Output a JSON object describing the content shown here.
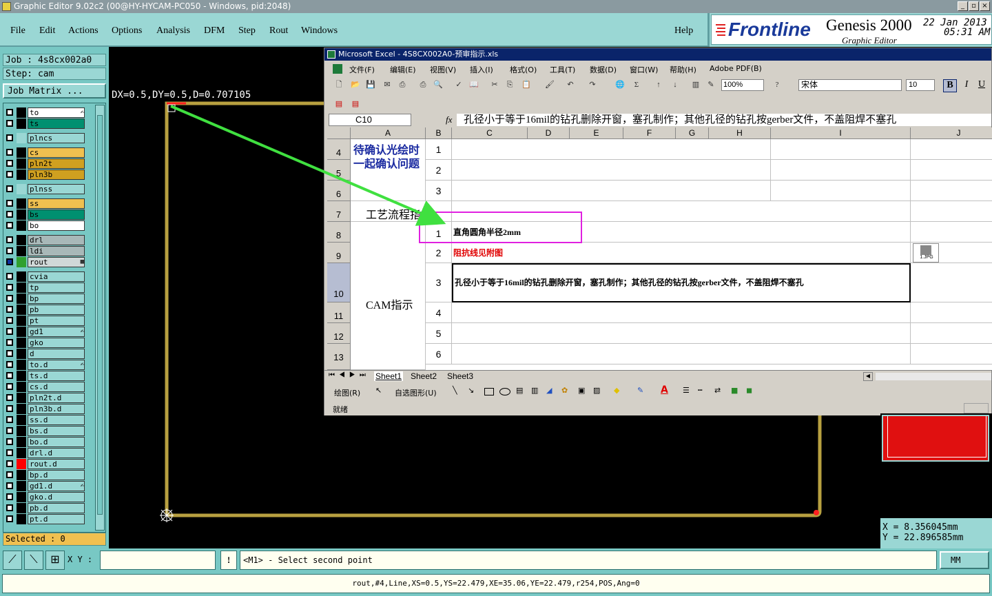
{
  "app": {
    "title": "Graphic Editor 9.02c2 (00@HY-HYCAM-PC050 - Windows, pid:2048)",
    "menu": [
      "File",
      "Edit",
      "Actions",
      "Options",
      "Analysis",
      "DFM",
      "Step",
      "Rout",
      "Windows"
    ],
    "help": "Help",
    "brand": "Frontline",
    "product": "Genesis 2000",
    "subtitle": "Graphic Editor",
    "date": "22 Jan 2013",
    "time": "05:31 AM"
  },
  "job": {
    "job_label": "Job : 4s8cx002a0",
    "step_label": "Step: cam",
    "matrix_button": "Job Matrix ...",
    "selected": "Selected : 0"
  },
  "layers": [
    {
      "name": "to",
      "color": "#ffffff",
      "sw": "#000000",
      "mark": "✍"
    },
    {
      "name": "ts",
      "color": "#009070",
      "sw": "#000000"
    },
    {
      "name": "plncs",
      "color": "#9ad7d4",
      "sw": "#9ad7d4"
    },
    {
      "name": "cs",
      "color": "#f0c050",
      "sw": "#000000"
    },
    {
      "name": "pln2t",
      "color": "#d0a020",
      "sw": "#000000"
    },
    {
      "name": "pln3b",
      "color": "#d0a020",
      "sw": "#000000"
    },
    {
      "name": "plnss",
      "color": "#9ad7d4",
      "sw": "#9ad7d4"
    },
    {
      "name": "ss",
      "color": "#f0c050",
      "sw": "#000000"
    },
    {
      "name": "bs",
      "color": "#009070",
      "sw": "#000000"
    },
    {
      "name": "bo",
      "color": "#ffffff",
      "sw": "#000000"
    },
    {
      "name": "drl",
      "color": "#a8b8b8",
      "sw": "#000000"
    },
    {
      "name": "ldi",
      "color": "#a8b8b8",
      "sw": "#000000"
    },
    {
      "name": "rout",
      "color": "#d0d8d8",
      "sw": "#30a030",
      "mark": "▦"
    },
    {
      "name": "cvia",
      "color": "#9ad7d4",
      "sw": "#000000"
    },
    {
      "name": "tp",
      "color": "#9ad7d4",
      "sw": "#000000"
    },
    {
      "name": "bp",
      "color": "#9ad7d4",
      "sw": "#000000"
    },
    {
      "name": "pb",
      "color": "#9ad7d4",
      "sw": "#000000"
    },
    {
      "name": "pt",
      "color": "#9ad7d4",
      "sw": "#000000"
    },
    {
      "name": "gd1",
      "color": "#9ad7d4",
      "sw": "#000000",
      "mark": "✍"
    },
    {
      "name": "gko",
      "color": "#9ad7d4",
      "sw": "#000000"
    },
    {
      "name": "d",
      "color": "#9ad7d4",
      "sw": "#000000"
    },
    {
      "name": "to.d",
      "color": "#9ad7d4",
      "sw": "#000000",
      "mark": "✍"
    },
    {
      "name": "ts.d",
      "color": "#9ad7d4",
      "sw": "#000000"
    },
    {
      "name": "cs.d",
      "color": "#9ad7d4",
      "sw": "#000000"
    },
    {
      "name": "pln2t.d",
      "color": "#9ad7d4",
      "sw": "#000000"
    },
    {
      "name": "pln3b.d",
      "color": "#9ad7d4",
      "sw": "#000000"
    },
    {
      "name": "ss.d",
      "color": "#9ad7d4",
      "sw": "#000000"
    },
    {
      "name": "bs.d",
      "color": "#9ad7d4",
      "sw": "#000000"
    },
    {
      "name": "bo.d",
      "color": "#9ad7d4",
      "sw": "#000000"
    },
    {
      "name": "drl.d",
      "color": "#9ad7d4",
      "sw": "#000000"
    },
    {
      "name": "rout.d",
      "color": "#9ad7d4",
      "sw": "#ff0000"
    },
    {
      "name": "bp.d",
      "color": "#9ad7d4",
      "sw": "#000000"
    },
    {
      "name": "gd1.d",
      "color": "#9ad7d4",
      "sw": "#000000",
      "mark": "✍"
    },
    {
      "name": "gko.d",
      "color": "#9ad7d4",
      "sw": "#000000"
    },
    {
      "name": "pb.d",
      "color": "#9ad7d4",
      "sw": "#000000"
    },
    {
      "name": "pt.d",
      "color": "#9ad7d4",
      "sw": "#000000"
    }
  ],
  "canvas": {
    "measure": "DX=0.5,DY=0.5,D=0.707105"
  },
  "excel": {
    "title": "Microsoft Excel - 4S8CX002A0-预审指示.xls",
    "menu": [
      "文件(F)",
      "编辑(E)",
      "视图(V)",
      "插入(I)",
      "格式(O)",
      "工具(T)",
      "数据(D)",
      "窗口(W)",
      "帮助(H)",
      "Adobe PDF(B)"
    ],
    "zoom": "100%",
    "font_name": "宋体",
    "font_size": "10",
    "bold": "B",
    "italic": "I",
    "underline": "U",
    "name_box": "C10",
    "fx": "fx",
    "formula": "孔径小于等于16mil的钻孔删除开窗，塞孔制作；其他孔径的钻孔按gerber文件，不盖阻焊不塞孔",
    "columns": [
      "A",
      "B",
      "C",
      "D",
      "E",
      "F",
      "G",
      "H",
      "I",
      "J"
    ],
    "rows": [
      "4",
      "5",
      "6",
      "7",
      "8",
      "9",
      "10",
      "11",
      "12",
      "13"
    ],
    "a_confirm": "待确认光绘时一起确认问题",
    "a_process": "工艺流程指示",
    "a_cam": "CAM指示",
    "b_nums_top": [
      "1",
      "2",
      "3"
    ],
    "b_nums_cam": [
      "1",
      "2",
      "3",
      "4",
      "5",
      "6"
    ],
    "cam_items": [
      "直角圆角半径2mm",
      "阻抗线见附图",
      "孔径小于等于16mil的钻孔删除开窗，塞孔制作；其他孔径的钻孔按gerber文件，不盖阻焊不塞孔"
    ],
    "attachment": "1.JPG",
    "sheets": [
      "Sheet1",
      "Sheet2",
      "Sheet3"
    ],
    "draw_label": "绘图(R)",
    "autoshape_label": "自选图形(U)",
    "status": "就绪"
  },
  "coords": {
    "x": "X  =  8.356045mm",
    "y": "Y  = 22.896585mm"
  },
  "bottom": {
    "xy_label": "X Y :",
    "prompt": "<M1> - Select second point",
    "units": "MM",
    "status_line": "rout,#4,Line,XS=0.5,YS=22.479,XE=35.06,YE=22.479,r254,POS,Ang=0"
  }
}
